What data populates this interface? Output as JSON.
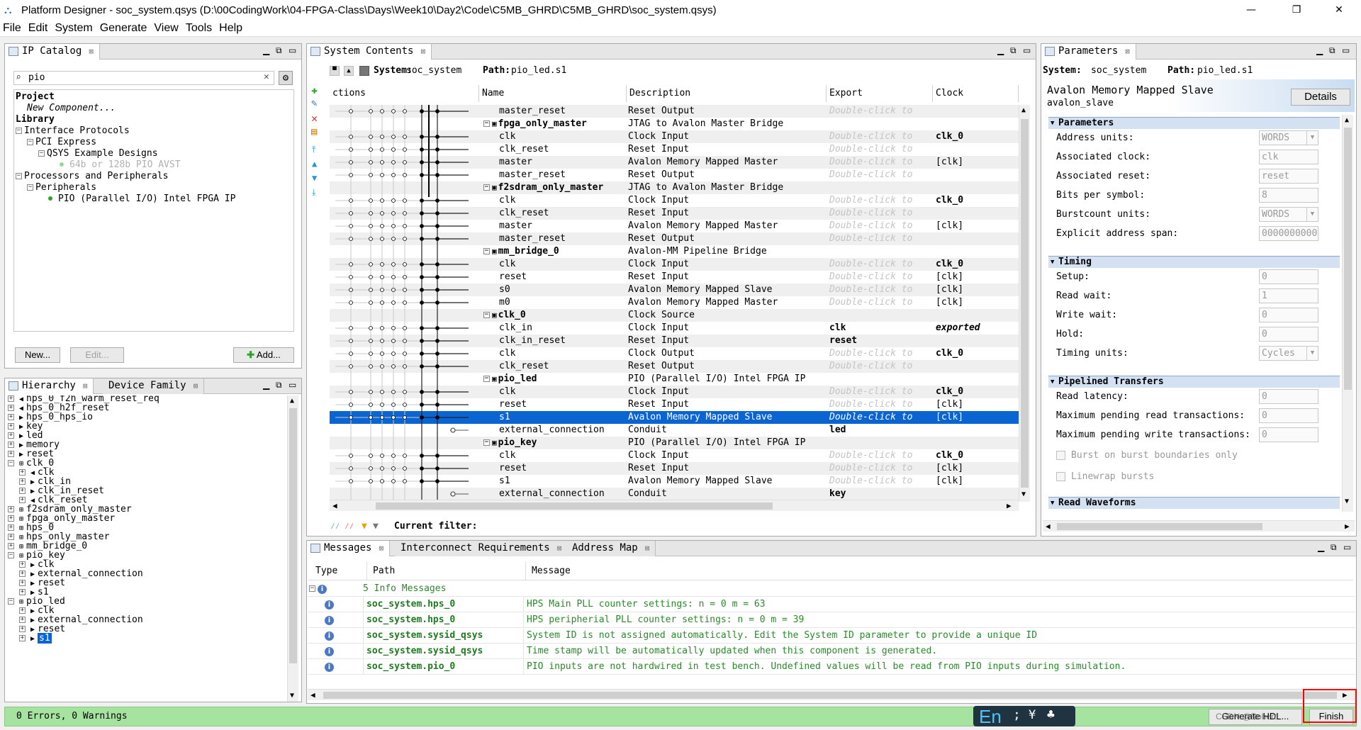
{
  "window": {
    "title": "Platform Designer - soc_system.qsys (D:\\00CodingWork\\04-FPGA-Class\\Days\\Week10\\Day2\\Code\\C5MB_GHRD\\C5MB_GHRD\\soc_system.qsys)",
    "controls": [
      "—",
      "❐",
      "✕"
    ]
  },
  "menu": [
    "File",
    "Edit",
    "System",
    "Generate",
    "View",
    "Tools",
    "Help"
  ],
  "ip_catalog": {
    "tab": "IP Catalog",
    "search_value": "pio",
    "tree": [
      {
        "label": "Project",
        "bold": true,
        "indent": 0
      },
      {
        "label": "New Component...",
        "italic": true,
        "indent": 1
      },
      {
        "label": "Library",
        "bold": true,
        "indent": 0
      },
      {
        "label": "Interface Protocols",
        "indent": 0,
        "exp": "−"
      },
      {
        "label": "PCI Express",
        "indent": 1,
        "exp": "−"
      },
      {
        "label": "QSYS Example Designs",
        "indent": 2,
        "exp": "−"
      },
      {
        "label": "64b or 128b PIO AVST",
        "indent": 3,
        "grey": true,
        "dot": true
      },
      {
        "label": "Processors and Peripherals",
        "indent": 0,
        "exp": "−"
      },
      {
        "label": "Peripherals",
        "indent": 1,
        "exp": "−"
      },
      {
        "label": "PIO (Parallel I/O) Intel FPGA IP",
        "indent": 2,
        "dot": true
      }
    ],
    "buttons": {
      "new": "New...",
      "edit": "Edit...",
      "add": "Add..."
    }
  },
  "hierarchy": {
    "tabs": [
      "Hierarchy",
      "Device Family"
    ],
    "items": [
      {
        "label": "hps_0_f2h_warm_reset_req",
        "indent": 0,
        "arrow": "in"
      },
      {
        "label": "hps_0_h2f_reset",
        "indent": 0,
        "arrow": "in"
      },
      {
        "label": "hps_0_hps_io",
        "indent": 0,
        "arrow": "out"
      },
      {
        "label": "key",
        "indent": 0,
        "arrow": "out"
      },
      {
        "label": "led",
        "indent": 0,
        "arrow": "out"
      },
      {
        "label": "memory",
        "indent": 0,
        "arrow": "out"
      },
      {
        "label": "reset",
        "indent": 0,
        "arrow": "out"
      },
      {
        "label": "clk_0",
        "indent": 0,
        "arrow": "comp",
        "open": true
      },
      {
        "label": "clk",
        "indent": 1,
        "arrow": "in"
      },
      {
        "label": "clk_in",
        "indent": 1,
        "arrow": "out"
      },
      {
        "label": "clk_in_reset",
        "indent": 1,
        "arrow": "out"
      },
      {
        "label": "clk_reset",
        "indent": 1,
        "arrow": "in"
      },
      {
        "label": "f2sdram_only_master",
        "indent": 0,
        "arrow": "comp"
      },
      {
        "label": "fpga_only_master",
        "indent": 0,
        "arrow": "comp"
      },
      {
        "label": "hps_0",
        "indent": 0,
        "arrow": "comp"
      },
      {
        "label": "hps_only_master",
        "indent": 0,
        "arrow": "comp"
      },
      {
        "label": "mm_bridge_0",
        "indent": 0,
        "arrow": "comp"
      },
      {
        "label": "pio_key",
        "indent": 0,
        "arrow": "comp",
        "open": true
      },
      {
        "label": "clk",
        "indent": 1,
        "arrow": "out"
      },
      {
        "label": "external_connection",
        "indent": 1,
        "arrow": "out"
      },
      {
        "label": "reset",
        "indent": 1,
        "arrow": "out"
      },
      {
        "label": "s1",
        "indent": 1,
        "arrow": "out"
      },
      {
        "label": "pio_led",
        "indent": 0,
        "arrow": "comp",
        "open": true
      },
      {
        "label": "clk",
        "indent": 1,
        "arrow": "out"
      },
      {
        "label": "external_connection",
        "indent": 1,
        "arrow": "out"
      },
      {
        "label": "reset",
        "indent": 1,
        "arrow": "out"
      },
      {
        "label": "s1",
        "indent": 1,
        "arrow": "out",
        "selected": true
      }
    ]
  },
  "system_contents": {
    "tab": "System Contents",
    "system_label": "System:",
    "system_name": "soc_system",
    "path_label": "Path:",
    "path_value": "pio_led.s1",
    "columns": [
      "ctions",
      "Name",
      "Description",
      "Export",
      "Clock"
    ],
    "filter_label": "Current filter:",
    "rows": [
      {
        "name": "master_reset",
        "desc": "Reset Output",
        "export": "Double-click to",
        "clock": "",
        "comp": false
      },
      {
        "name": "fpga_only_master",
        "desc": "JTAG to Avalon Master Bridge",
        "export": "",
        "clock": "",
        "comp": true
      },
      {
        "name": "clk",
        "desc": "Clock Input",
        "export": "Double-click to",
        "clock": "clk_0",
        "comp": false
      },
      {
        "name": "clk_reset",
        "desc": "Reset Input",
        "export": "Double-click to",
        "clock": "",
        "comp": false
      },
      {
        "name": "master",
        "desc": "Avalon Memory Mapped Master",
        "export": "Double-click to",
        "clock": "[clk]",
        "comp": false
      },
      {
        "name": "master_reset",
        "desc": "Reset Output",
        "export": "Double-click to",
        "clock": "",
        "comp": false
      },
      {
        "name": "f2sdram_only_master",
        "desc": "JTAG to Avalon Master Bridge",
        "export": "",
        "clock": "",
        "comp": true
      },
      {
        "name": "clk",
        "desc": "Clock Input",
        "export": "Double-click to",
        "clock": "clk_0",
        "comp": false
      },
      {
        "name": "clk_reset",
        "desc": "Reset Input",
        "export": "Double-click to",
        "clock": "",
        "comp": false
      },
      {
        "name": "master",
        "desc": "Avalon Memory Mapped Master",
        "export": "Double-click to",
        "clock": "[clk]",
        "comp": false
      },
      {
        "name": "master_reset",
        "desc": "Reset Output",
        "export": "Double-click to",
        "clock": "",
        "comp": false
      },
      {
        "name": "mm_bridge_0",
        "desc": "Avalon-MM Pipeline Bridge",
        "export": "",
        "clock": "",
        "comp": true
      },
      {
        "name": "clk",
        "desc": "Clock Input",
        "export": "Double-click to",
        "clock": "clk_0",
        "comp": false
      },
      {
        "name": "reset",
        "desc": "Reset Input",
        "export": "Double-click to",
        "clock": "[clk]",
        "comp": false
      },
      {
        "name": "s0",
        "desc": "Avalon Memory Mapped Slave",
        "export": "Double-click to",
        "clock": "[clk]",
        "comp": false
      },
      {
        "name": "m0",
        "desc": "Avalon Memory Mapped Master",
        "export": "Double-click to",
        "clock": "[clk]",
        "comp": false
      },
      {
        "name": "clk_0",
        "desc": "Clock Source",
        "export": "",
        "clock": "",
        "comp": true
      },
      {
        "name": "clk_in",
        "desc": "Clock Input",
        "export": "clk",
        "clock": "exported",
        "comp": false
      },
      {
        "name": "clk_in_reset",
        "desc": "Reset Input",
        "export": "reset",
        "clock": "",
        "comp": false
      },
      {
        "name": "clk",
        "desc": "Clock Output",
        "export": "Double-click to",
        "clock": "clk_0",
        "comp": false
      },
      {
        "name": "clk_reset",
        "desc": "Reset Output",
        "export": "Double-click to",
        "clock": "",
        "comp": false
      },
      {
        "name": "pio_led",
        "desc": "PIO (Parallel I/O) Intel FPGA IP",
        "export": "",
        "clock": "",
        "comp": true
      },
      {
        "name": "clk",
        "desc": "Clock Input",
        "export": "Double-click to",
        "clock": "clk_0",
        "comp": false
      },
      {
        "name": "reset",
        "desc": "Reset Input",
        "export": "Double-click to",
        "clock": "[clk]",
        "comp": false
      },
      {
        "name": "s1",
        "desc": "Avalon Memory Mapped Slave",
        "export": "Double-click to",
        "clock": "[clk]",
        "comp": false,
        "selected": true
      },
      {
        "name": "external_connection",
        "desc": "Conduit",
        "export": "led",
        "clock": "",
        "comp": false
      },
      {
        "name": "pio_key",
        "desc": "PIO (Parallel I/O) Intel FPGA IP",
        "export": "",
        "clock": "",
        "comp": true
      },
      {
        "name": "clk",
        "desc": "Clock Input",
        "export": "Double-click to",
        "clock": "clk_0",
        "comp": false
      },
      {
        "name": "reset",
        "desc": "Reset Input",
        "export": "Double-click to",
        "clock": "[clk]",
        "comp": false
      },
      {
        "name": "s1",
        "desc": "Avalon Memory Mapped Slave",
        "export": "Double-click to",
        "clock": "[clk]",
        "comp": false
      },
      {
        "name": "external_connection",
        "desc": "Conduit",
        "export": "key",
        "clock": "",
        "comp": false
      }
    ]
  },
  "parameters": {
    "tab": "Parameters",
    "system_label": "System:",
    "system_name": "soc_system",
    "path_label": "Path:",
    "path_value": "pio_led.s1",
    "heading": "Avalon Memory Mapped Slave",
    "subheading": "avalon_slave",
    "details_button": "Details",
    "sections": [
      {
        "title": "Parameters",
        "fields": [
          {
            "label": "Address units:",
            "value": "WORDS",
            "combo": true
          },
          {
            "label": "Associated clock:",
            "value": "clk"
          },
          {
            "label": "Associated reset:",
            "value": "reset"
          },
          {
            "label": "Bits per symbol:",
            "value": "8"
          },
          {
            "label": "Burstcount units:",
            "value": "WORDS",
            "combo": true
          },
          {
            "label": "Explicit address span:",
            "value": "00000000000000"
          }
        ]
      },
      {
        "title": "Timing",
        "fields": [
          {
            "label": "Setup:",
            "value": "0"
          },
          {
            "label": "Read wait:",
            "value": "1"
          },
          {
            "label": "Write wait:",
            "value": "0"
          },
          {
            "label": "Hold:",
            "value": "0"
          },
          {
            "label": "Timing units:",
            "value": "Cycles",
            "combo": true
          }
        ]
      },
      {
        "title": "Pipelined Transfers",
        "fields": [
          {
            "label": "Read latency:",
            "value": "0"
          },
          {
            "label": "Maximum pending read transactions:",
            "value": "0"
          },
          {
            "label": "Maximum pending write transactions:",
            "value": "0"
          }
        ],
        "checks": [
          "Burst on burst boundaries only",
          "Linewrap bursts"
        ]
      },
      {
        "title": "Read Waveforms",
        "fields": []
      }
    ]
  },
  "messages": {
    "tabs": [
      "Messages",
      "Interconnect Requirements",
      "Address Map"
    ],
    "columns": [
      "Type",
      "Path",
      "Message"
    ],
    "group": "5 Info Messages",
    "rows": [
      {
        "path": "soc_system.hps_0",
        "message": "HPS Main PLL counter settings: n = 0 m = 63"
      },
      {
        "path": "soc_system.hps_0",
        "message": "HPS peripherial PLL counter settings: n = 0 m = 39"
      },
      {
        "path": "soc_system.sysid_qsys",
        "message": "System ID is not assigned automatically. Edit the System ID parameter to provide a unique ID"
      },
      {
        "path": "soc_system.sysid_qsys",
        "message": "Time stamp will be automatically updated when this component is generated."
      },
      {
        "path": "soc_system.pio_0",
        "message": "PIO inputs are not hardwired in test bench. Undefined values will be read from PIO inputs during simulation."
      }
    ]
  },
  "status": {
    "text": "0 Errors, 0 Warnings",
    "generate_button": "Generate HDL...",
    "finish_button": "Finish",
    "ime": "En",
    "watermark": "CSDN @Robert"
  },
  "colors": {
    "selection": "#0a64d2",
    "status_green": "#a6e3a1",
    "path_green": "#1f7a1f",
    "message_green": "#2a8a2a",
    "highlight_red": "#ff0000"
  }
}
